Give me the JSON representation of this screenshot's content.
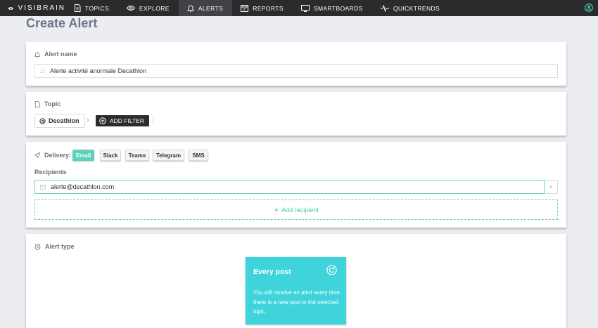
{
  "nav": {
    "brand": "VISIBRAIN",
    "items": [
      {
        "label": "TOPICS",
        "icon": "document-icon"
      },
      {
        "label": "EXPLORE",
        "icon": "eye-icon"
      },
      {
        "label": "ALERTS",
        "icon": "bell-icon",
        "active": true
      },
      {
        "label": "REPORTS",
        "icon": "calendar-icon"
      },
      {
        "label": "SMARTBOARDS",
        "icon": "monitor-icon"
      },
      {
        "label": "QUICKTRENDS",
        "icon": "pulse-icon"
      }
    ],
    "user_icon": "user-circle-icon"
  },
  "page": {
    "title": "Create Alert"
  },
  "alert_name": {
    "label": "Alert name",
    "value": "Alerte activité anormale Decathlon"
  },
  "topic": {
    "label": "Topic",
    "selected": "Decathlon",
    "add_filter": "ADD FILTER"
  },
  "delivery": {
    "label": "Delivery:",
    "channels": [
      {
        "label": "Email",
        "active": true
      },
      {
        "label": "Slack",
        "active": false
      },
      {
        "label": "Teams",
        "active": false
      },
      {
        "label": "Telegram",
        "active": false
      },
      {
        "label": "SMS",
        "active": false
      }
    ],
    "recipients_label": "Recipients",
    "recipients": [
      "alerte@decathlon.com"
    ],
    "remove": "×",
    "add_recipient": "Add recipient"
  },
  "alert_type": {
    "label": "Alert type",
    "selected_title": "Every post",
    "selected_desc": "You will receive an alert every time there is a new post in the selected topic."
  },
  "colors": {
    "nav_bg": "#2b2b2e",
    "accent": "#5fd0b8",
    "type_card": "#3fd3dc"
  }
}
